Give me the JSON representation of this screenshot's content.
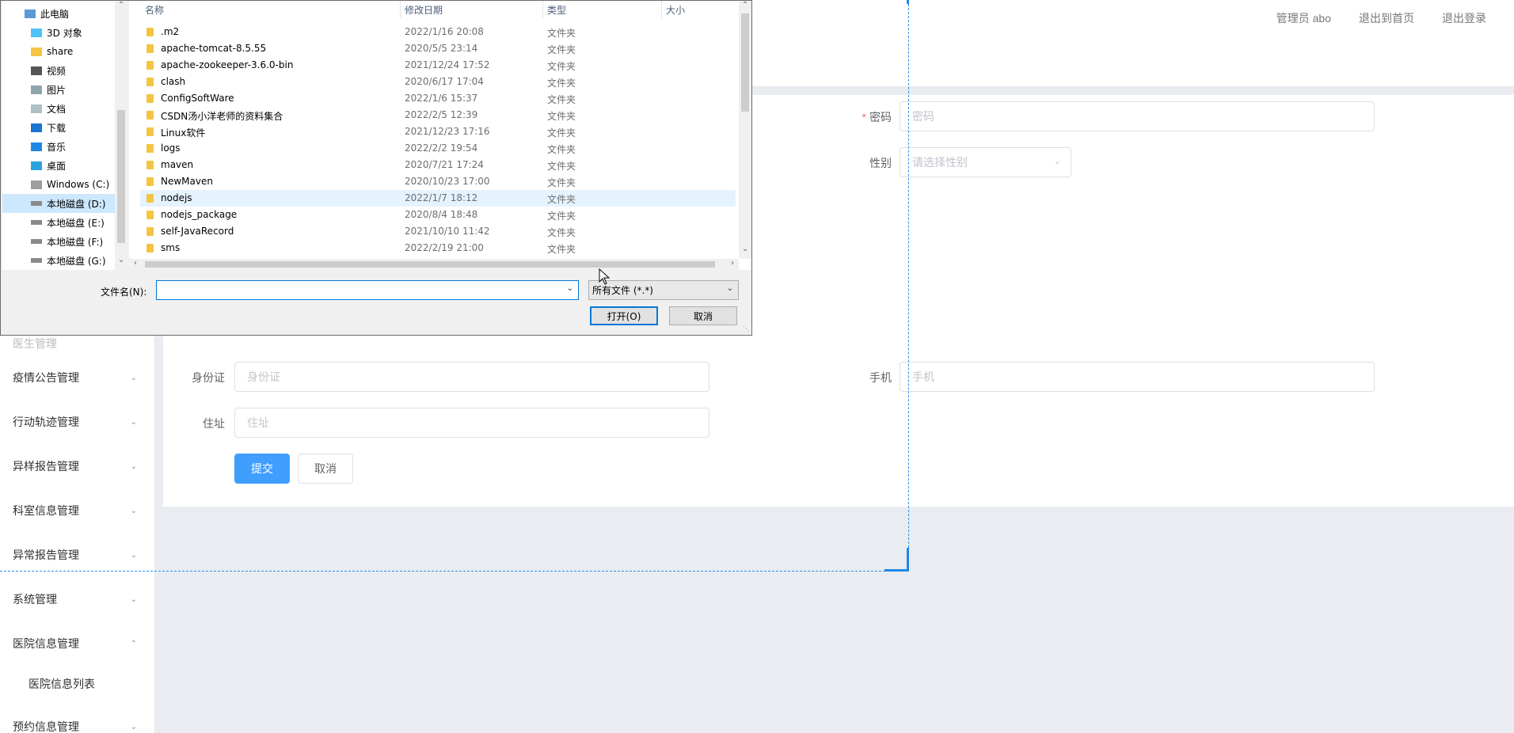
{
  "header": {
    "links": [
      "管理员 abo",
      "退出到首页",
      "退出登录"
    ]
  },
  "sidebar": {
    "partial_item": "医生管理",
    "items": [
      {
        "label": "疫情公告管理",
        "chevron": "down"
      },
      {
        "label": "行动轨迹管理",
        "chevron": "down"
      },
      {
        "label": "异样报告管理",
        "chevron": "down"
      },
      {
        "label": "科室信息管理",
        "chevron": "down"
      },
      {
        "label": "异常报告管理",
        "chevron": "down"
      },
      {
        "label": "系统管理",
        "chevron": "down"
      },
      {
        "label": "医院信息管理",
        "chevron": "up"
      },
      {
        "label": "医院信息列表",
        "chevron": ""
      },
      {
        "label": "预约信息管理",
        "chevron": "down"
      }
    ]
  },
  "form": {
    "password_label": "密码",
    "password_placeholder": "密码",
    "gender_label": "性别",
    "gender_placeholder": "请选择性别",
    "idcard_label": "身份证",
    "idcard_placeholder": "身份证",
    "phone_label": "手机",
    "phone_placeholder": "手机",
    "address_label": "住址",
    "address_placeholder": "住址",
    "submit_label": "提交",
    "cancel_label": "取消"
  },
  "dialog": {
    "nav_items": [
      {
        "label": "此电脑",
        "icon": "computer-icon"
      },
      {
        "label": "3D 对象",
        "icon": "3d-objects-icon"
      },
      {
        "label": "share",
        "icon": "folder-icon"
      },
      {
        "label": "视频",
        "icon": "video-icon"
      },
      {
        "label": "图片",
        "icon": "pictures-icon"
      },
      {
        "label": "文档",
        "icon": "documents-icon"
      },
      {
        "label": "下载",
        "icon": "download-icon"
      },
      {
        "label": "音乐",
        "icon": "music-icon"
      },
      {
        "label": "桌面",
        "icon": "desktop-icon"
      },
      {
        "label": "Windows (C:)",
        "icon": "windows-drive-icon"
      },
      {
        "label": "本地磁盘 (D:)",
        "icon": "drive-icon"
      },
      {
        "label": "本地磁盘 (E:)",
        "icon": "drive-icon"
      },
      {
        "label": "本地磁盘 (F:)",
        "icon": "drive-icon"
      },
      {
        "label": "本地磁盘 (G:)",
        "icon": "drive-icon"
      }
    ],
    "selected_nav": "本地磁盘 (D:)",
    "columns": [
      "名称",
      "修改日期",
      "类型",
      "大小"
    ],
    "files": [
      {
        "name": ".m2",
        "date": "2022/1/16 20:08",
        "type": "文件夹"
      },
      {
        "name": "apache-tomcat-8.5.55",
        "date": "2020/5/5 23:14",
        "type": "文件夹"
      },
      {
        "name": "apache-zookeeper-3.6.0-bin",
        "date": "2021/12/24 17:52",
        "type": "文件夹"
      },
      {
        "name": "clash",
        "date": "2020/6/17 17:04",
        "type": "文件夹"
      },
      {
        "name": "ConfigSoftWare",
        "date": "2022/1/6 15:37",
        "type": "文件夹"
      },
      {
        "name": "CSDN汤小洋老师的资料集合",
        "date": "2022/2/5 12:39",
        "type": "文件夹"
      },
      {
        "name": "Linux软件",
        "date": "2021/12/23 17:16",
        "type": "文件夹"
      },
      {
        "name": "logs",
        "date": "2022/2/2 19:54",
        "type": "文件夹"
      },
      {
        "name": "maven",
        "date": "2020/7/21 17:24",
        "type": "文件夹"
      },
      {
        "name": "NewMaven",
        "date": "2020/10/23 17:00",
        "type": "文件夹"
      },
      {
        "name": "nodejs",
        "date": "2022/1/7 18:12",
        "type": "文件夹"
      },
      {
        "name": "nodejs_package",
        "date": "2020/8/4 18:48",
        "type": "文件夹"
      },
      {
        "name": "self-JavaRecord",
        "date": "2021/10/10 11:42",
        "type": "文件夹"
      },
      {
        "name": "sms",
        "date": "2022/2/19 21:00",
        "type": "文件夹"
      }
    ],
    "selected_file": "nodejs",
    "filename_label": "文件名(N):",
    "filename_value": "",
    "filetype_value": "所有文件 (*.*)",
    "open_label": "打开(O)",
    "cancel_label": "取消"
  },
  "colors": {
    "primary": "#409eff",
    "selection_dashed": "#2d8cf0",
    "page_bg": "#e9edf1",
    "required": "#f56c6c"
  }
}
